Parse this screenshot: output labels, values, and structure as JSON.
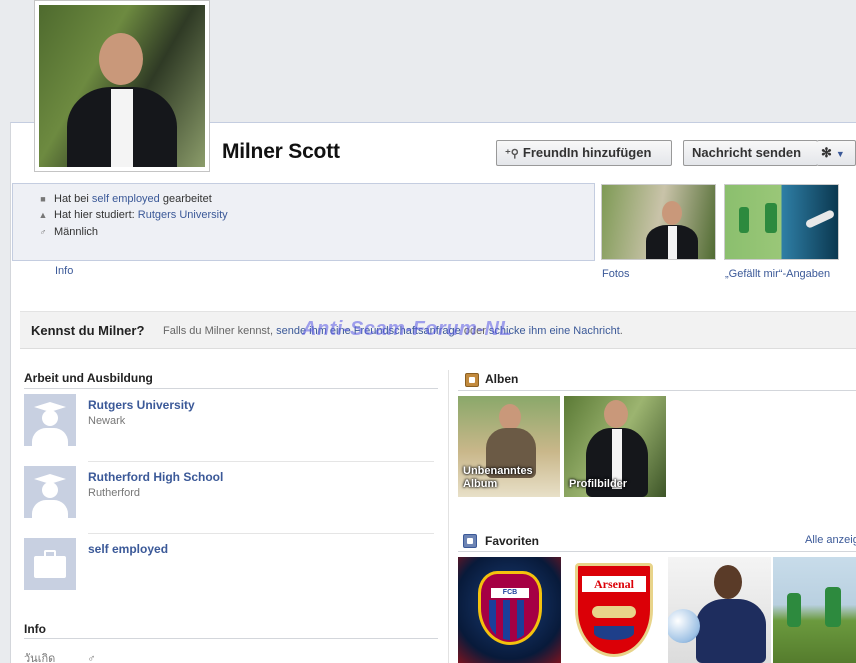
{
  "profile": {
    "name": "Milner Scott",
    "buttons": {
      "add_friend": "FreundIn hinzufügen",
      "send_message": "Nachricht senden"
    },
    "summary": {
      "work_prefix": "Hat bei ",
      "work_link": "self employed",
      "work_suffix": " gearbeitet",
      "study_prefix": "Hat hier studiert: ",
      "study_link": "Rutgers University",
      "gender": "Männlich"
    },
    "info_link": "Info",
    "thumbnails": {
      "photos_label": "Fotos",
      "likes_label": "„Gefällt mir“-Angaben"
    }
  },
  "know_bar": {
    "title": "Kennst du Milner?",
    "text_prefix": "Falls du Milner kennst, ",
    "text_link_1": "sende ihm eine Freundschaftsanfrage",
    "text_mid": " oder ",
    "text_link_2": "schicke ihm eine Nachricht",
    "text_suffix": ".",
    "watermark": "Anti-Scam-Forum-NL"
  },
  "work_education": {
    "title": "Arbeit und Ausbildung",
    "items": [
      {
        "name": "Rutgers University",
        "sub": "Newark",
        "icon": "graduation-icon"
      },
      {
        "name": "Rutherford High School",
        "sub": "Rutherford",
        "icon": "graduation-icon"
      },
      {
        "name": "self employed",
        "sub": "",
        "icon": "briefcase-icon"
      }
    ]
  },
  "info_section": {
    "title": "Info",
    "row_label": "วันเกิด"
  },
  "albums": {
    "title": "Alben",
    "items": [
      {
        "label_line1": "Unbenanntes",
        "label_line2": "Album"
      },
      {
        "label_line1": "Profilbilder",
        "label_line2": ""
      }
    ]
  },
  "favorites": {
    "title": "Favoriten",
    "all_link": "Alle anzeig",
    "crests": {
      "fcb": "FCB",
      "arsenal": "Arsenal"
    }
  },
  "colors": {
    "link": "#3b5998",
    "watermark": "#5a5ae6"
  }
}
